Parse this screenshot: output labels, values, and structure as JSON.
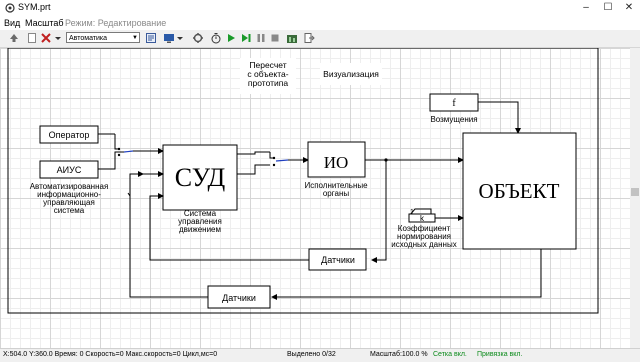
{
  "window": {
    "title": "SYM.prt"
  },
  "menu": {
    "view": "Вид",
    "scale": "Масштаб",
    "mode": "Режим: Редактирование"
  },
  "toolbar": {
    "mode_value": "Автоматика"
  },
  "diagram": {
    "operator": "Оператор",
    "aius": "АИУС",
    "aius_caption": [
      "Автоматизированная",
      "информационно-",
      "управляющая",
      "система"
    ],
    "sud": "СУД",
    "sud_caption": [
      "Система",
      "управления",
      "движением"
    ],
    "io": "ИО",
    "io_caption": [
      "Исполнительные",
      "органы"
    ],
    "object": "ОБЪЕКТ",
    "f": "f",
    "f_caption": "Возмущения",
    "recalc": [
      "Пересчет",
      "с объекта-",
      "прототипа"
    ],
    "visual": "Визуализация",
    "k_top": "1",
    "k_box": "k",
    "k_caption": [
      "Коэффициент",
      "нормирования",
      "исходных данных"
    ],
    "sensors1": "Датчики",
    "sensors2": "Датчики"
  },
  "status": {
    "coords": "X:504.0  Y:360.0 Время: 0 Скорость=0 Макс.скорость=0 Цикл,мс=0",
    "selected": "Выделено 0/32",
    "scale": "Масштаб:100.0 %",
    "grid": "Сетка вкл.",
    "snap": "Привязка вкл."
  },
  "colors": {
    "accent_green": "#0a8a1a",
    "wire_blue": "#1f3fbf",
    "grid": "#d6d6d6"
  }
}
